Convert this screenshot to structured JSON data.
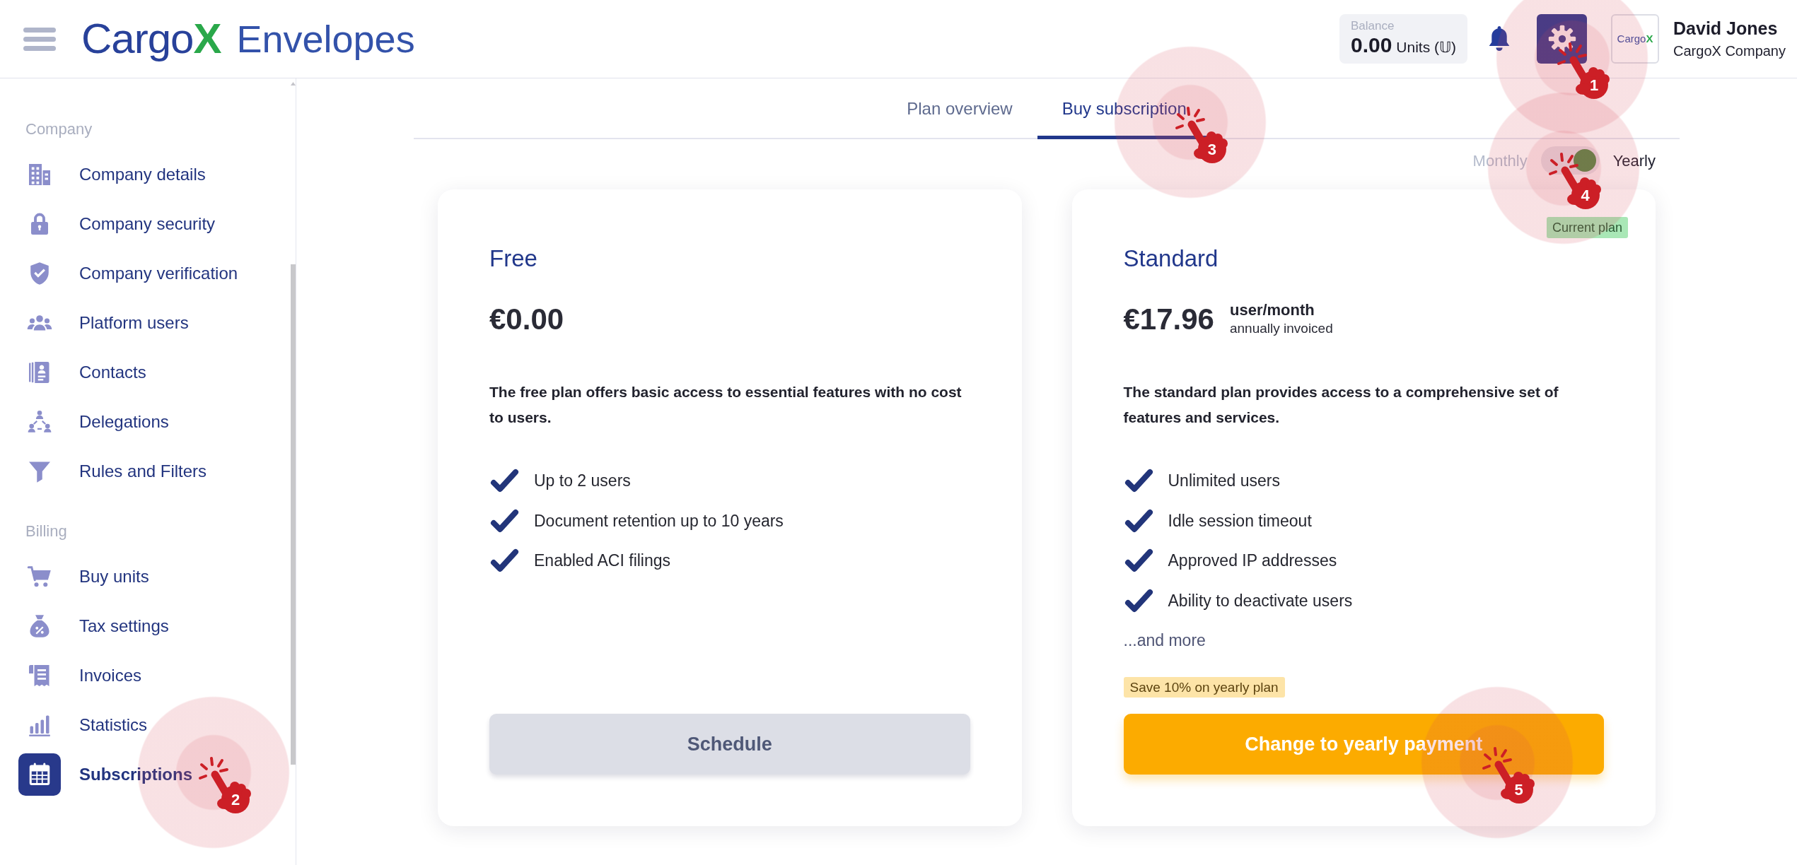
{
  "header": {
    "logo": {
      "name": "Cargo",
      "accent": "X",
      "product": "Envelopes"
    },
    "balance": {
      "label": "Balance",
      "amount": "0.00",
      "unit": "Units (𝕌)"
    },
    "settings_button": {
      "step": "1"
    },
    "company_logo": {
      "name": "Cargo",
      "accent": "X"
    },
    "user": {
      "name": "David Jones",
      "company": "CargoX Company"
    }
  },
  "sidebar": {
    "sections": [
      {
        "title": "Company",
        "items": [
          {
            "label": "Company details",
            "selected": false
          },
          {
            "label": "Company security",
            "selected": false
          },
          {
            "label": "Company verification",
            "selected": false
          },
          {
            "label": "Platform users",
            "selected": false
          },
          {
            "label": "Contacts",
            "selected": false
          },
          {
            "label": "Delegations",
            "selected": false
          },
          {
            "label": "Rules and Filters",
            "selected": false
          }
        ]
      },
      {
        "title": "Billing",
        "items": [
          {
            "label": "Buy units",
            "selected": false
          },
          {
            "label": "Tax settings",
            "selected": false
          },
          {
            "label": "Invoices",
            "selected": false
          },
          {
            "label": "Statistics",
            "selected": false
          },
          {
            "label": "Subscriptions",
            "selected": true,
            "step": "2"
          }
        ]
      }
    ]
  },
  "tabs": [
    {
      "label": "Plan overview",
      "selected": false
    },
    {
      "label": "Buy subscription",
      "selected": true,
      "step": "3"
    }
  ],
  "billing_period": {
    "labels": [
      "Monthly",
      "Yearly"
    ],
    "on": true,
    "step": "4"
  },
  "plans": [
    {
      "name": "Free",
      "price": "€0.00",
      "description": "The free plan offers basic access to essential features with no cost to users.",
      "features": [
        "Up to 2 users",
        "Document retention up to 10 years",
        "Enabled ACI filings"
      ],
      "button": {
        "label": "Schedule",
        "kind": "secondary"
      }
    },
    {
      "name": "Standard",
      "badge": "Current plan",
      "price": "€17.96",
      "price_unit": "user/month",
      "price_note": "annually invoiced",
      "description": "The standard plan provides access to a comprehensive set of features and services.",
      "features": [
        "Unlimited users",
        "Idle session timeout",
        "Approved IP addresses",
        "Ability to deactivate users"
      ],
      "more": "...and more",
      "promo": "Save 10% on yearly plan",
      "button": {
        "label": "Change to yearly payment",
        "kind": "primary",
        "step": "5"
      }
    }
  ]
}
